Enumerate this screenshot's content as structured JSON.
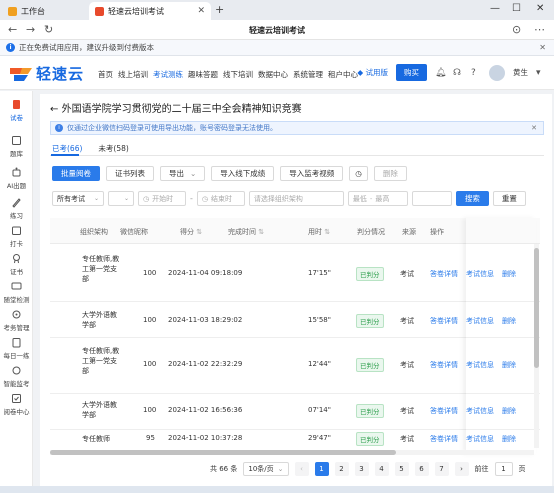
{
  "browser": {
    "tabs": [
      {
        "label": "工作台",
        "active": false
      },
      {
        "label": "轻速云培训考试",
        "active": true
      }
    ],
    "page_title": "轻速云培训考试"
  },
  "notice": {
    "text": "正在免费试用应用，建议升级到付费版本"
  },
  "header": {
    "logo_text": "轻速云",
    "menu": [
      "首页",
      "线上培训",
      "考试测练",
      "趣味答题",
      "线下培训",
      "数据中心",
      "系统管理",
      "租户中心"
    ],
    "active_menu": "考试测练",
    "trial_label": "试用版",
    "buy_label": "购买",
    "user_name": "黄生"
  },
  "sidebar": {
    "items": [
      "试卷",
      "题库",
      "AI出题",
      "练习",
      "打卡",
      "证书",
      "随堂检测",
      "考务管理",
      "每日一练",
      "智能监考",
      "阅卷中心"
    ],
    "active": "试卷"
  },
  "page": {
    "title": "外国语学院学习贯彻党的二十届三中全会精神知识竞赛",
    "tip": "仅通过企业微信扫码登录可使用导出功能，账号密码登录无法使用。",
    "tabs": [
      {
        "label": "已考(66)",
        "active": true
      },
      {
        "label": "未考(58)",
        "active": false
      }
    ]
  },
  "toolbar": {
    "batch_grade": "批量阅卷",
    "cert_list": "证书列表",
    "export": "导出",
    "import_offline": "导入线下成绩",
    "import_video": "导入监考视频",
    "delete": "删除"
  },
  "filters": {
    "exam_type": "所有考试",
    "start_time_placeholder": "开始时",
    "end_time_placeholder": "结束时",
    "org_placeholder": "请选择组织架构",
    "min_placeholder": "最低",
    "max_placeholder": "最高",
    "search": "搜索",
    "reset": "重置"
  },
  "table": {
    "columns": [
      "组织架构",
      "微信昵称",
      "得分",
      "完成时间",
      "用时",
      "判分情况",
      "来源",
      "操作"
    ],
    "rows": [
      {
        "org": "专任教师,教工第一党支部",
        "nickname": "",
        "score": "100",
        "finish_time": "2024-11-04 09:18:09",
        "duration": "17'15\"",
        "status": "已判分",
        "source": "考试"
      },
      {
        "org": "大学外语教学部",
        "nickname": "",
        "score": "100",
        "finish_time": "2024-11-03 18:29:02",
        "duration": "15'58\"",
        "status": "已判分",
        "source": "考试"
      },
      {
        "org": "专任教师,教工第一党支部",
        "nickname": "",
        "score": "100",
        "finish_time": "2024-11-02 22:32:29",
        "duration": "12'44\"",
        "status": "已判分",
        "source": "考试"
      },
      {
        "org": "大学外语教学部",
        "nickname": "",
        "score": "100",
        "finish_time": "2024-11-02 16:56:36",
        "duration": "07'14\"",
        "status": "已判分",
        "source": "考试"
      },
      {
        "org": "专任教师",
        "nickname": "",
        "score": "95",
        "finish_time": "2024-11-02 10:37:28",
        "duration": "29'47\"",
        "status": "已判分",
        "source": "考试"
      }
    ],
    "actions": [
      "答卷详情",
      "考试信息",
      "删除"
    ]
  },
  "pagination": {
    "total": "共 66 条",
    "page_size": "10条/页",
    "pages": [
      "1",
      "2",
      "3",
      "4",
      "5",
      "6",
      "7"
    ],
    "current": "1",
    "goto_label": "前往",
    "goto_value": "1",
    "page_suffix": "页"
  }
}
